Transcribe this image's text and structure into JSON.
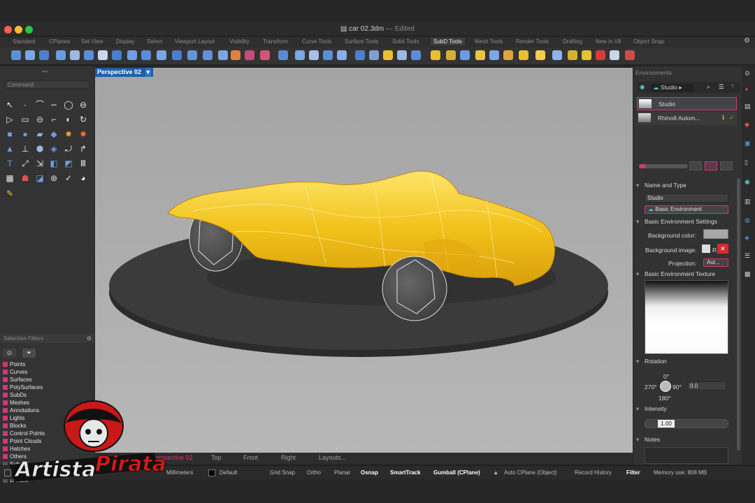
{
  "window": {
    "title": "car 02.3dm",
    "state": "— Edited"
  },
  "tabs": [
    "Standard",
    "CPlanes",
    "Set View",
    "Display",
    "Select",
    "Viewport Layout",
    "Visibility",
    "Transform",
    "Curve Tools",
    "Surface Tools",
    "Solid Tools",
    "SubD Tools",
    "Mesh Tools",
    "Render Tools",
    "Drafting",
    "New in V8",
    "Object Snap"
  ],
  "active_tab": "SubD Tools",
  "command": {
    "placeholder": "Command"
  },
  "selection_filters": {
    "title": "Selection Filters",
    "items": [
      {
        "label": "Points",
        "checked": true
      },
      {
        "label": "Curves",
        "checked": true
      },
      {
        "label": "Surfaces",
        "checked": true
      },
      {
        "label": "PolySurfaces",
        "checked": true
      },
      {
        "label": "SubDs",
        "checked": true
      },
      {
        "label": "Meshes",
        "checked": true
      },
      {
        "label": "Annotations",
        "checked": true
      },
      {
        "label": "Lights",
        "checked": true
      },
      {
        "label": "Blocks",
        "checked": true
      },
      {
        "label": "Control Points",
        "checked": true
      },
      {
        "label": "Point Clouds",
        "checked": true
      },
      {
        "label": "Hatches",
        "checked": true
      },
      {
        "label": "Others",
        "checked": true
      },
      {
        "label": "Sub-objects",
        "checked": false
      }
    ],
    "disable_label": "Disable"
  },
  "viewport": {
    "title": "Perspective 02",
    "tabs": [
      "Perspective 02",
      "Top",
      "Front",
      "Right",
      "Layouts..."
    ]
  },
  "status_bar": {
    "units": "Millimeters",
    "layer": "Default",
    "toggles": [
      {
        "label": "Grid Snap",
        "on": false
      },
      {
        "label": "Ortho",
        "on": false
      },
      {
        "label": "Planar",
        "on": false
      },
      {
        "label": "Osnap",
        "on": true
      },
      {
        "label": "SmartTrack",
        "on": true
      },
      {
        "label": "Gumball (CPlane)",
        "on": true
      },
      {
        "label": "Auto CPlane (Object)",
        "on": false
      },
      {
        "label": "Record History",
        "on": false
      },
      {
        "label": "Filter",
        "on": true
      }
    ],
    "memory": "Memory use: 808 MB"
  },
  "environments": {
    "title": "Environments",
    "current": "Studio",
    "list": [
      "Studio",
      "Rhino8 Autom..."
    ],
    "name_and_type": "Name and Type",
    "name_value": "Studio",
    "type_value": "Basic Environment",
    "basic_settings": "Basic Environment Settings",
    "background_color_label": "Background color:",
    "background_image_label": "Background image:",
    "projection_label": "Projection:",
    "projection_value": "Aut...",
    "texture_title": "Basic Environment Texture",
    "rotation_title": "Rotation",
    "rot_0": "0°",
    "rot_90": "90°",
    "rot_180": "180°",
    "rot_270": "270°",
    "rotation_value": "0.0",
    "intensity_title": "Intensity",
    "intensity_value": "1.00",
    "notes_title": "Notes"
  },
  "watermark": "ArtistaPirata",
  "colors": {
    "accent": "#d0377a",
    "viewport_title": "#1f5fa8",
    "car": "#f2c21a"
  }
}
